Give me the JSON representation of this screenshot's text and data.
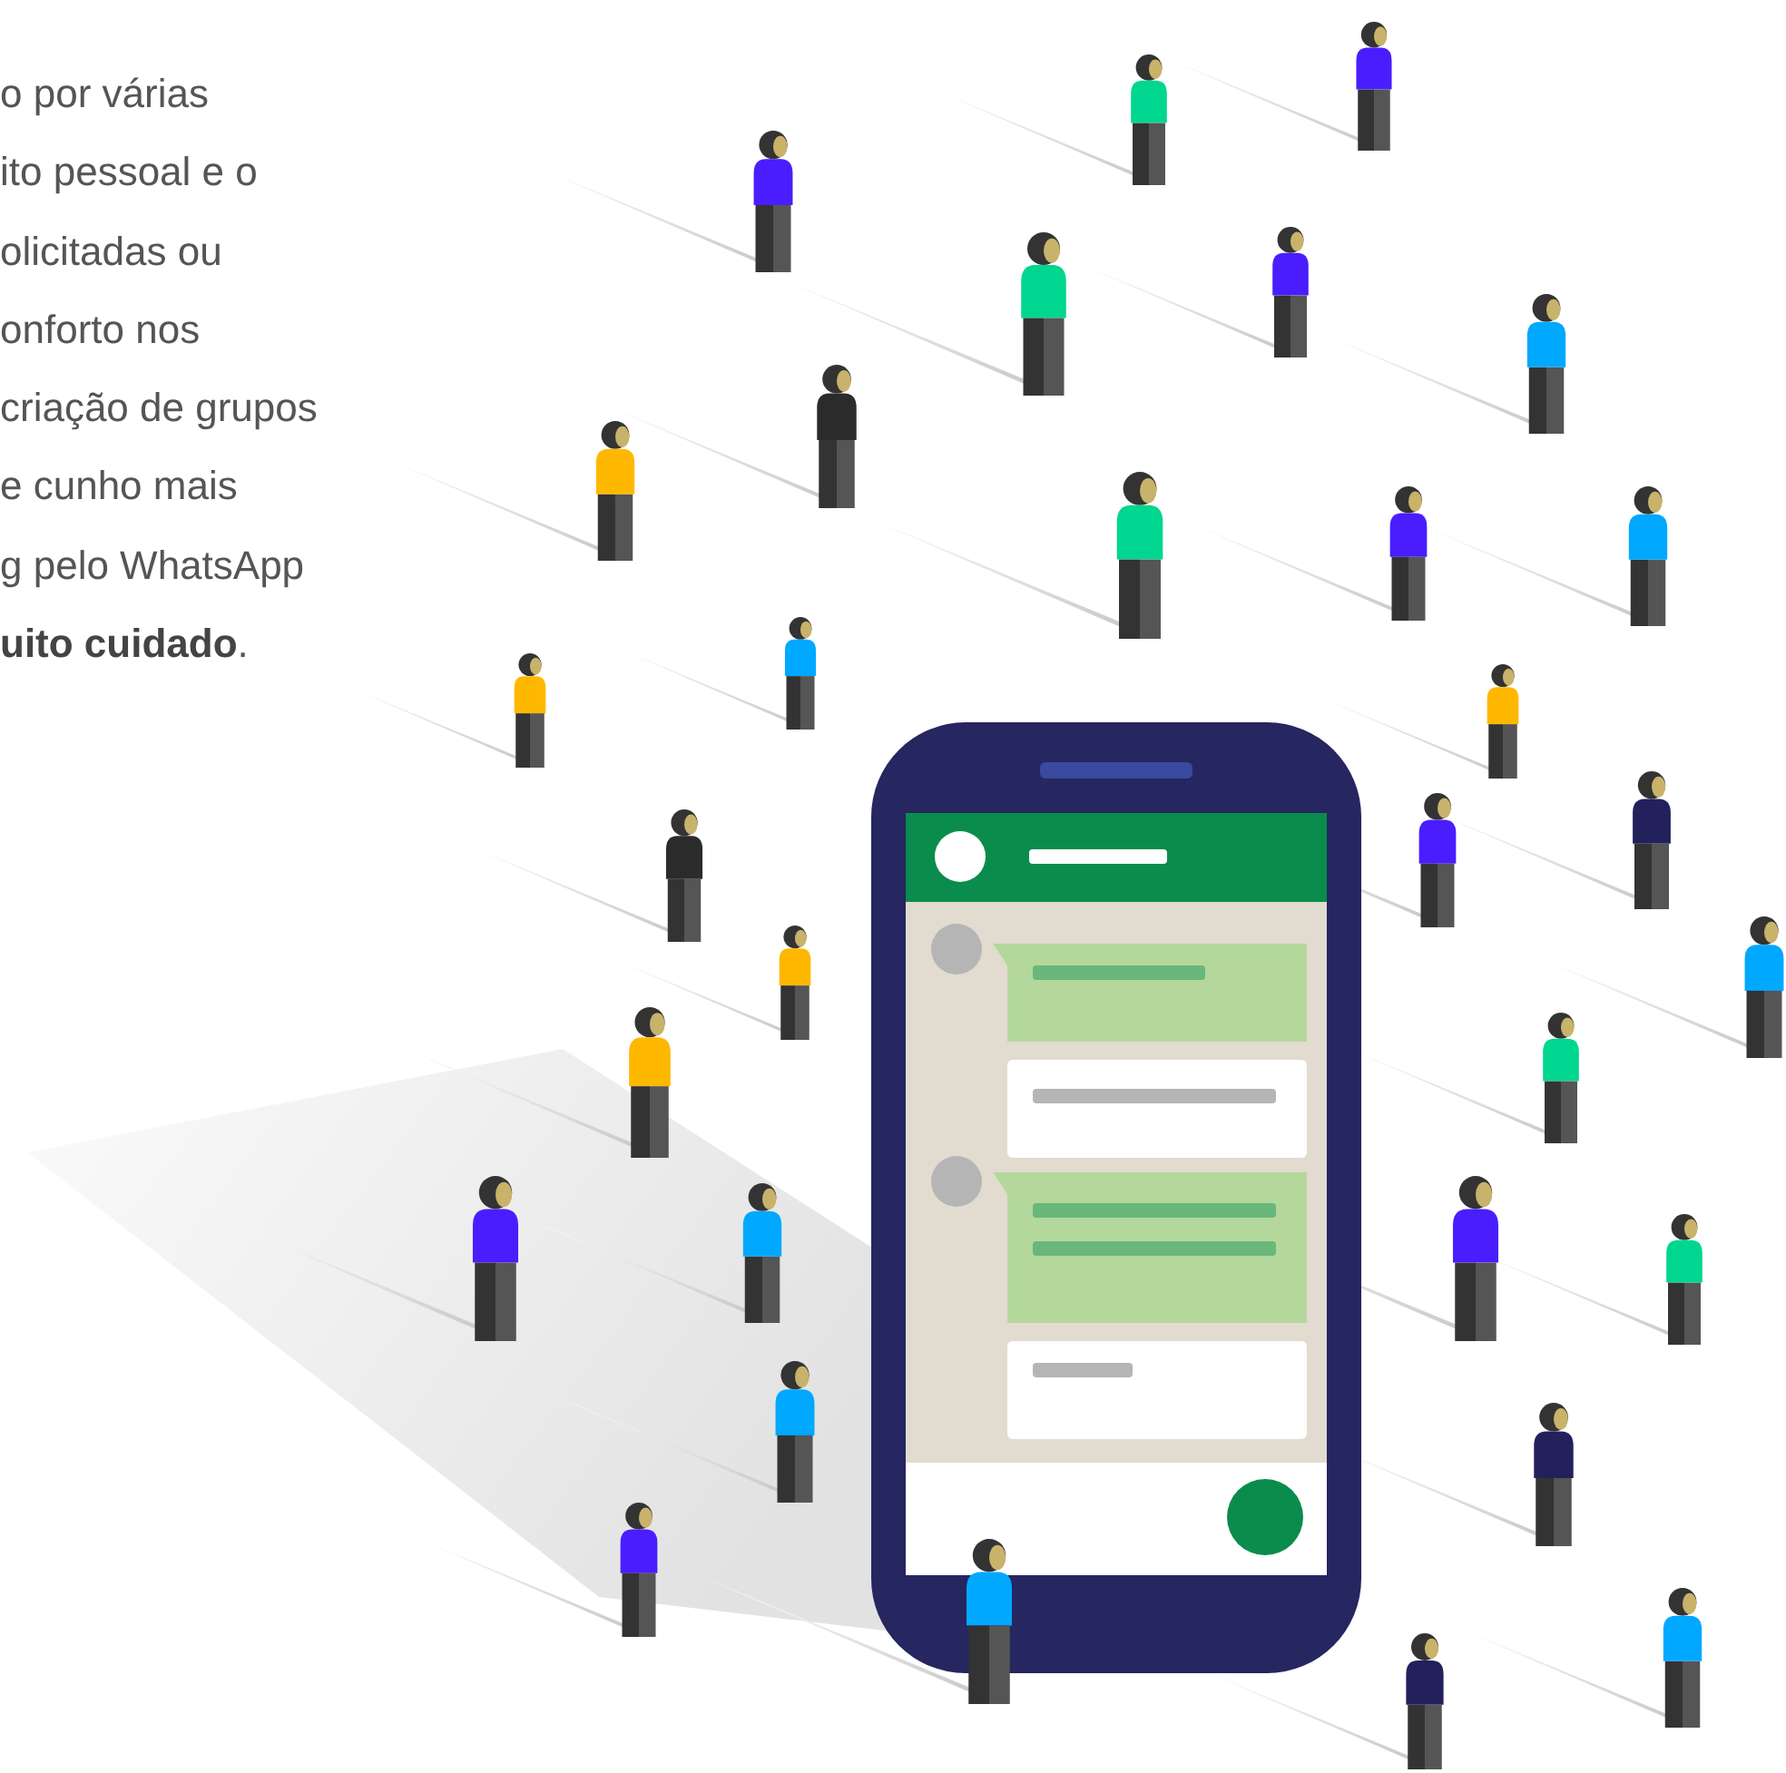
{
  "paragraph": {
    "lines": [
      "o por várias",
      "ito pessoal e o",
      "olicitadas ou",
      "onforto nos",
      "criação de grupos",
      "e cunho mais",
      "g pelo WhatsApp",
      "**uito cuidado**."
    ]
  }
}
